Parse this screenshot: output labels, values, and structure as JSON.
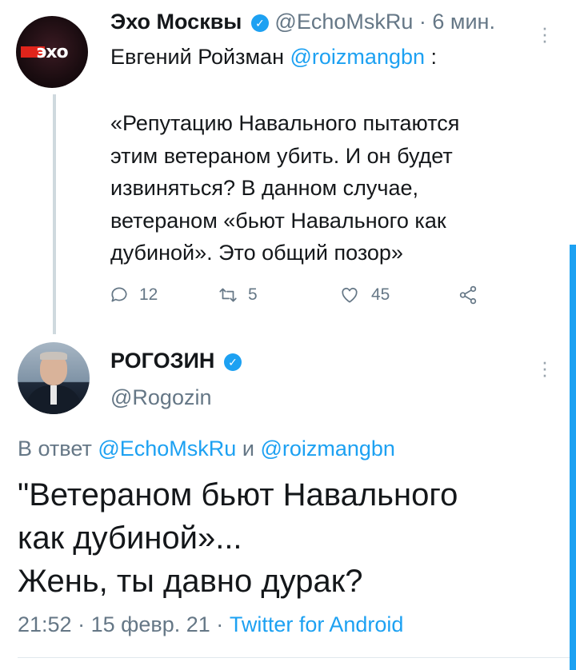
{
  "tweet1": {
    "name": "Эхо Москвы",
    "handle": "@EchoMskRu",
    "time": "· 6 мин.",
    "avatar_text": "эхо",
    "quoted_author": "Евгений Ройзман",
    "quoted_handle": "@roizmangbn",
    "quoted_suffix": ":",
    "text_lines": [
      "«Репутацию Навального пытаются",
      "этим ветераном убить. И он будет",
      "извиняться? В данном случае,",
      "ветераном «бьют Навального как",
      "дубиной». Это общий позор»"
    ],
    "replies": "12",
    "retweets": "5",
    "likes": "45"
  },
  "tweet2": {
    "name": "РОГОЗИН",
    "handle": "@Rogozin",
    "reply_prefix": "В ответ",
    "reply_user1": "@EchoMskRu",
    "reply_and": "и",
    "reply_user2": "@roizmangbn",
    "text_lines": [
      "\"Ветераном бьют Навального",
      "как дубиной»...",
      "Жень, ты давно дурак?"
    ],
    "time": "21:52",
    "date": "15 февр. 21",
    "client": "Twitter for Android"
  },
  "colors": {
    "accent": "#1da1f2",
    "muted": "#657786",
    "text": "#14171a",
    "thread_line": "#cfd9de"
  },
  "icons": [
    "verified-icon",
    "more-icon",
    "reply-icon",
    "retweet-icon",
    "like-icon",
    "share-icon"
  ]
}
